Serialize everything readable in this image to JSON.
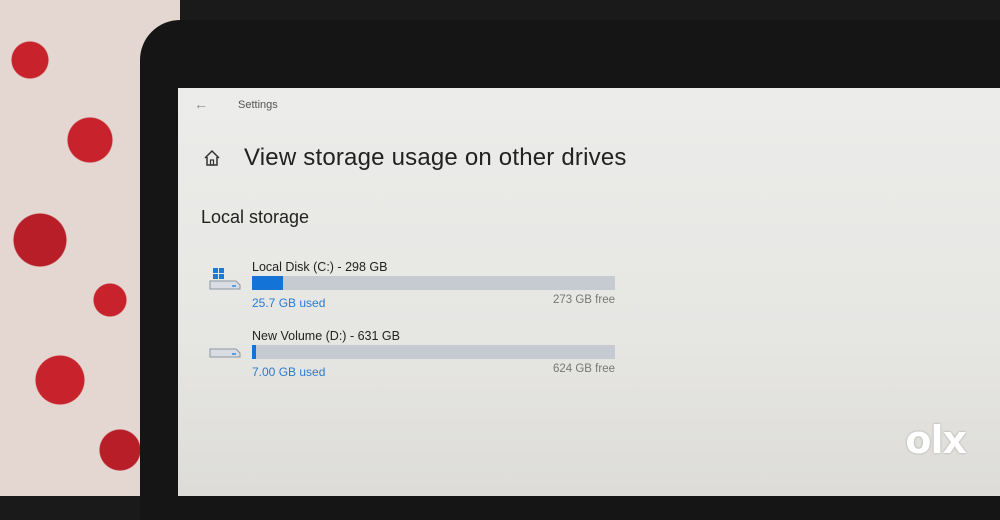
{
  "app": {
    "title": "Settings"
  },
  "page": {
    "title": "View storage usage on other drives"
  },
  "section": {
    "title": "Local storage"
  },
  "drives": [
    {
      "name": "Local Disk (C:) - 298 GB",
      "used": "25.7 GB used",
      "free": "273 GB free",
      "used_fraction": 0.086,
      "icon": "windows-drive-icon"
    },
    {
      "name": "New Volume (D:) - 631 GB",
      "used": "7.00 GB used",
      "free": "624 GB free",
      "used_fraction": 0.011,
      "icon": "drive-icon"
    }
  ],
  "watermark": {
    "text": "OLX"
  },
  "colors": {
    "accent": "#1473d6",
    "bar_track": "#c6cbd2",
    "used_text": "#2a7bd1"
  }
}
